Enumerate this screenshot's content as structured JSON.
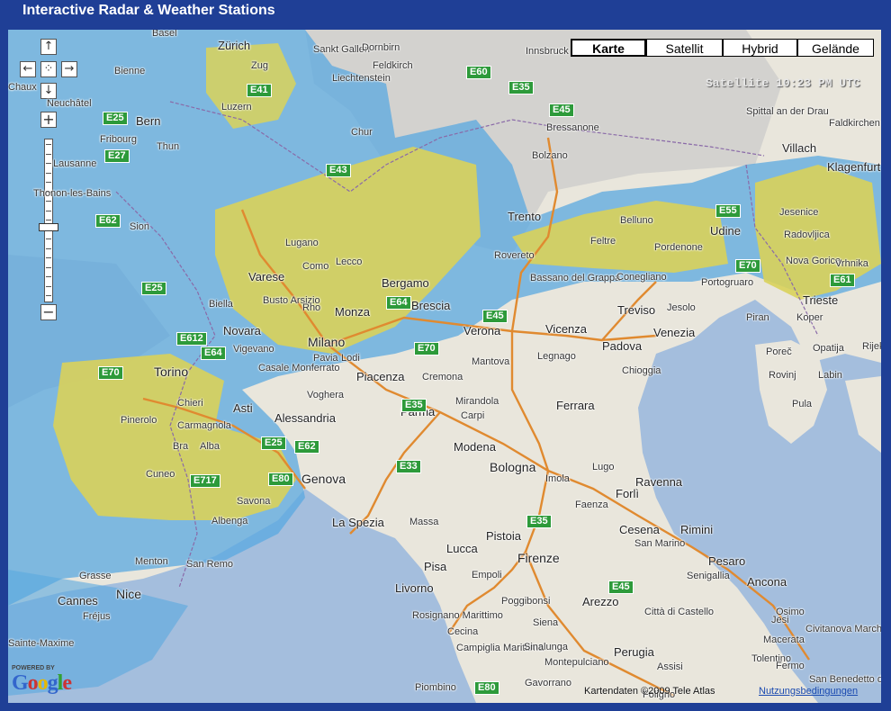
{
  "header": {
    "title": "Interactive Radar & Weather Stations"
  },
  "map_types": {
    "karte": "Karte",
    "satellit": "Satellit",
    "hybrid": "Hybrid",
    "gelaende": "Gelände",
    "selected": "Karte"
  },
  "controls": {
    "pan_up": "↑",
    "pan_left": "←",
    "pan_center": "⁘",
    "pan_right": "→",
    "pan_down": "↓",
    "zoom_in": "+",
    "zoom_out": "−"
  },
  "overlay": {
    "timestamp": "Satellite 10:23 PM UTC"
  },
  "footer": {
    "copyright": "Kartendaten ©2009 Tele Atlas",
    "terms": "Nutzungsbedingungen",
    "powered_by": "POWERED BY",
    "google": "Google"
  },
  "colors": {
    "sea": "#a4bedd",
    "land": "#e9e6dc",
    "radar_blue": "#5aa8e0",
    "radar_yellow": "#d9d25a",
    "cloud_gray": "#bbbbbb",
    "road_label": "#2d9a3a",
    "title_bar": "#1f3f96"
  },
  "cities": [
    {
      "name": "Zürich",
      "size": "mid"
    },
    {
      "name": "Basel",
      "size": "small"
    },
    {
      "name": "Sankt Gallen",
      "size": "small"
    },
    {
      "name": "Dornbirn",
      "size": "small"
    },
    {
      "name": "Feldkirch",
      "size": "small"
    },
    {
      "name": "Liechtenstein",
      "size": "small"
    },
    {
      "name": "Innsbruck",
      "size": "small"
    },
    {
      "name": "Bienne",
      "size": "small"
    },
    {
      "name": "Chaux",
      "size": "small"
    },
    {
      "name": "Neuchâtel",
      "size": "small"
    },
    {
      "name": "Bern",
      "size": "mid"
    },
    {
      "name": "Fribourg",
      "size": "small"
    },
    {
      "name": "Lausanne",
      "size": "small"
    },
    {
      "name": "Thun",
      "size": "small"
    },
    {
      "name": "Luzern",
      "size": "small"
    },
    {
      "name": "Zug",
      "size": "small"
    },
    {
      "name": "Chur",
      "size": "small"
    },
    {
      "name": "Thonon-les-Bains",
      "size": "small"
    },
    {
      "name": "Sion",
      "size": "small"
    },
    {
      "name": "Bolzano",
      "size": "small"
    },
    {
      "name": "Bressanone",
      "size": "small"
    },
    {
      "name": "Padova",
      "size": "mid"
    },
    {
      "name": "Villach",
      "size": "mid"
    },
    {
      "name": "Klagenfurt",
      "size": "mid"
    },
    {
      "name": "Spittal an der Drau",
      "size": "small"
    },
    {
      "name": "Faldkirchen",
      "size": "small"
    },
    {
      "name": "Jesenice",
      "size": "small"
    },
    {
      "name": "Radovljica",
      "size": "small"
    },
    {
      "name": "Trento",
      "size": "mid"
    },
    {
      "name": "Belluno",
      "size": "small"
    },
    {
      "name": "Feltre",
      "size": "small"
    },
    {
      "name": "Pordenone",
      "size": "small"
    },
    {
      "name": "Udine",
      "size": "mid"
    },
    {
      "name": "Rovereto",
      "size": "small"
    },
    {
      "name": "Lugano",
      "size": "small"
    },
    {
      "name": "Como",
      "size": "small"
    },
    {
      "name": "Lecco",
      "size": "small"
    },
    {
      "name": "Varese",
      "size": "mid"
    },
    {
      "name": "Bergamo",
      "size": "mid"
    },
    {
      "name": "Busto Arsizio",
      "size": "small"
    },
    {
      "name": "Rho",
      "size": "small"
    },
    {
      "name": "Monza",
      "size": "mid"
    },
    {
      "name": "Milano",
      "size": "big"
    },
    {
      "name": "Biella",
      "size": "small"
    },
    {
      "name": "Novara",
      "size": "mid"
    },
    {
      "name": "Vigevano",
      "size": "small"
    },
    {
      "name": "Brescia",
      "size": "mid"
    },
    {
      "name": "Bassano del Grappa",
      "size": "small"
    },
    {
      "name": "Conegliano",
      "size": "small"
    },
    {
      "name": "Portogruaro",
      "size": "small"
    },
    {
      "name": "Nova Gorica",
      "size": "small"
    },
    {
      "name": "Vrhnika",
      "size": "small"
    },
    {
      "name": "Trieste",
      "size": "mid"
    },
    {
      "name": "Koper",
      "size": "small"
    },
    {
      "name": "Piran",
      "size": "small"
    },
    {
      "name": "Verona",
      "size": "mid"
    },
    {
      "name": "Vicenza",
      "size": "mid"
    },
    {
      "name": "Treviso",
      "size": "mid"
    },
    {
      "name": "Jesolo",
      "size": "small"
    },
    {
      "name": "Venezia",
      "size": "mid"
    },
    {
      "name": "Mantova",
      "size": "small"
    },
    {
      "name": "Legnago",
      "size": "small"
    },
    {
      "name": "Chioggia",
      "size": "small"
    },
    {
      "name": "Poreč",
      "size": "small"
    },
    {
      "name": "Opatija",
      "size": "small"
    },
    {
      "name": "Rovinj",
      "size": "small"
    },
    {
      "name": "Labin",
      "size": "small"
    },
    {
      "name": "Pula",
      "size": "small"
    },
    {
      "name": "Torino",
      "size": "big"
    },
    {
      "name": "Chieri",
      "size": "small"
    },
    {
      "name": "Asti",
      "size": "mid"
    },
    {
      "name": "Casale Monferrato",
      "size": "small"
    },
    {
      "name": "Pavia",
      "size": "small"
    },
    {
      "name": "Lodi",
      "size": "small"
    },
    {
      "name": "Piacenza",
      "size": "mid"
    },
    {
      "name": "Cremona",
      "size": "small"
    },
    {
      "name": "Voghera",
      "size": "small"
    },
    {
      "name": "Alessandria",
      "size": "mid"
    },
    {
      "name": "Pinerolo",
      "size": "small"
    },
    {
      "name": "Carmagnola",
      "size": "small"
    },
    {
      "name": "Bra",
      "size": "small"
    },
    {
      "name": "Alba",
      "size": "small"
    },
    {
      "name": "Cuneo",
      "size": "small"
    },
    {
      "name": "Savona",
      "size": "small"
    },
    {
      "name": "Genova",
      "size": "big"
    },
    {
      "name": "Albenga",
      "size": "small"
    },
    {
      "name": "Parma",
      "size": "mid"
    },
    {
      "name": "Mirandola",
      "size": "small"
    },
    {
      "name": "Carpi",
      "size": "small"
    },
    {
      "name": "Ferrara",
      "size": "mid"
    },
    {
      "name": "Modena",
      "size": "mid"
    },
    {
      "name": "Bologna",
      "size": "big"
    },
    {
      "name": "Lugo",
      "size": "small"
    },
    {
      "name": "Ravenna",
      "size": "mid"
    },
    {
      "name": "Imola",
      "size": "small"
    },
    {
      "name": "Forlì",
      "size": "mid"
    },
    {
      "name": "Faenza",
      "size": "small"
    },
    {
      "name": "Cesena",
      "size": "mid"
    },
    {
      "name": "Rimini",
      "size": "mid"
    },
    {
      "name": "San Marino",
      "size": "small"
    },
    {
      "name": "Pesaro",
      "size": "mid"
    },
    {
      "name": "Senigallia",
      "size": "small"
    },
    {
      "name": "Ancona",
      "size": "mid"
    },
    {
      "name": "Osimo",
      "size": "small"
    },
    {
      "name": "Jesi",
      "size": "small"
    },
    {
      "name": "Civitanova Marche",
      "size": "small"
    },
    {
      "name": "Macerata",
      "size": "small"
    },
    {
      "name": "Tolentino",
      "size": "small"
    },
    {
      "name": "Fermo",
      "size": "small"
    },
    {
      "name": "San Benedetto del Tronto",
      "size": "small"
    },
    {
      "name": "La Spezia",
      "size": "mid"
    },
    {
      "name": "Massa",
      "size": "small"
    },
    {
      "name": "Lucca",
      "size": "mid"
    },
    {
      "name": "Pistoia",
      "size": "mid"
    },
    {
      "name": "Pisa",
      "size": "mid"
    },
    {
      "name": "Empoli",
      "size": "small"
    },
    {
      "name": "Firenze",
      "size": "big"
    },
    {
      "name": "Livorno",
      "size": "mid"
    },
    {
      "name": "Poggibonsi",
      "size": "small"
    },
    {
      "name": "Arezzo",
      "size": "mid"
    },
    {
      "name": "Città di Castello",
      "size": "small"
    },
    {
      "name": "Rosignano Marittimo",
      "size": "small"
    },
    {
      "name": "Cecina",
      "size": "small"
    },
    {
      "name": "Siena",
      "size": "small"
    },
    {
      "name": "Campiglia Marittima",
      "size": "small"
    },
    {
      "name": "Sinalunga",
      "size": "small"
    },
    {
      "name": "Perugia",
      "size": "mid"
    },
    {
      "name": "Assisi",
      "size": "small"
    },
    {
      "name": "Montepulciano",
      "size": "small"
    },
    {
      "name": "Gavorrano",
      "size": "small"
    },
    {
      "name": "Piombino",
      "size": "small"
    },
    {
      "name": "Foligno",
      "size": "small"
    },
    {
      "name": "Grasse",
      "size": "small"
    },
    {
      "name": "Menton",
      "size": "small"
    },
    {
      "name": "San Remo",
      "size": "small"
    },
    {
      "name": "Cannes",
      "size": "mid"
    },
    {
      "name": "Nice",
      "size": "big"
    },
    {
      "name": "Fréjus",
      "size": "small"
    },
    {
      "name": "Sainte-Maxime",
      "size": "small"
    },
    {
      "name": "Rijeka",
      "size": "small"
    }
  ],
  "roads": [
    "E60",
    "E45",
    "E35",
    "E25",
    "E41",
    "E43",
    "E27",
    "E62",
    "E25",
    "E64",
    "E612",
    "E64",
    "E70",
    "E25",
    "E62",
    "E717",
    "E80",
    "E45",
    "E70",
    "E35",
    "E33",
    "E35",
    "E45",
    "E80",
    "E55",
    "E70",
    "E61"
  ]
}
